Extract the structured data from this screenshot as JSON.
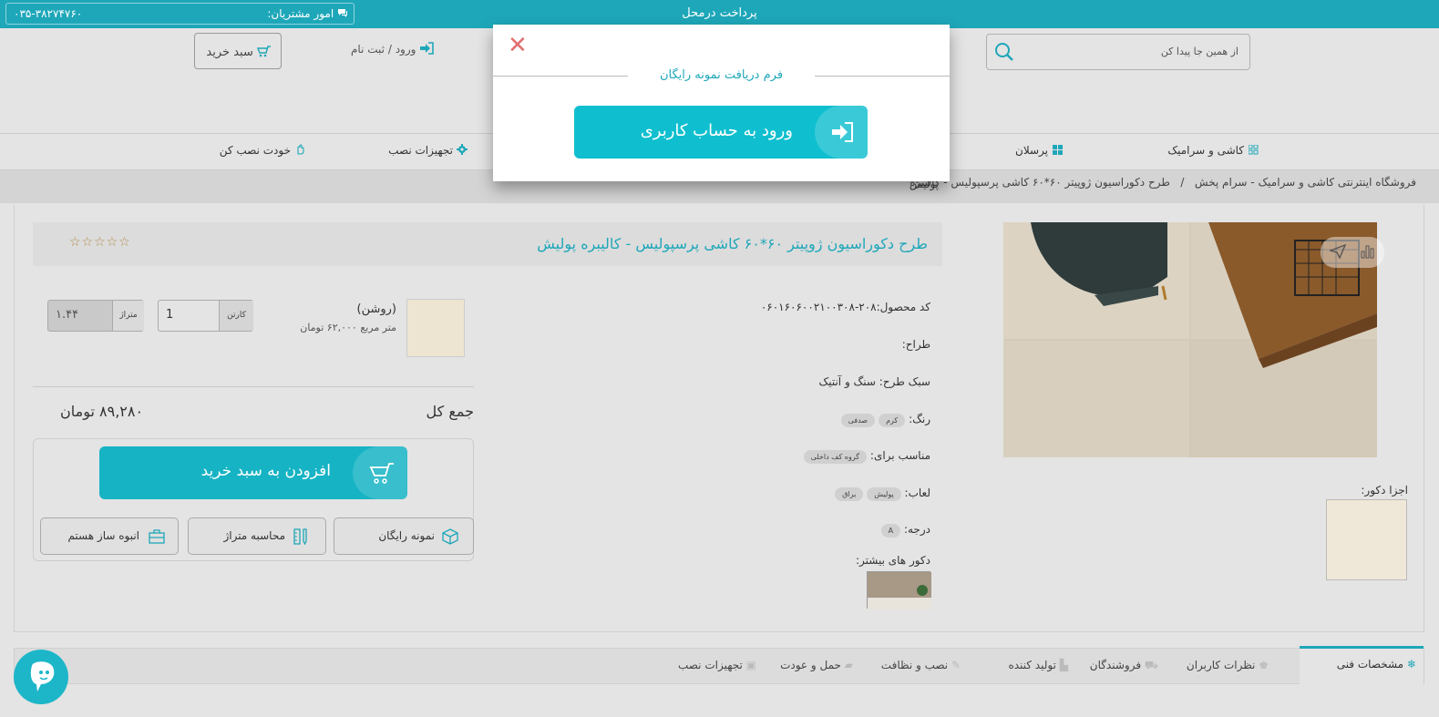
{
  "topbar": {
    "title": "پرداخت درمحل",
    "customer_service_label": "امور مشتریان:",
    "phone": "۰۳۵-۳۸۲۷۴۷۶۰"
  },
  "header": {
    "search_placeholder": "از همین جا پیدا کن",
    "login_label": "ورود",
    "register_label": "ثبت نام",
    "login_separator": "/",
    "cart_label": "سبد خرید"
  },
  "nav": {
    "items": [
      {
        "label": "کاشی و سرامیک",
        "icon": "tiles-icon"
      },
      {
        "label": "پرسلان",
        "icon": "grid-icon"
      },
      {
        "label": "تجهیزات نصب",
        "icon": "gear-icon"
      },
      {
        "label": "خودت نصب کن",
        "icon": "hand-icon"
      }
    ]
  },
  "breadcrumb": {
    "home": "فروشگاه اینترنتی کاشی و سرامیک - سرام پخش",
    "separator": "/",
    "current_line1": "طرح دکوراسیون ژوپیتر ۶۰*۶۰ کاشی پرسپولیس - کالیبره",
    "current_line2": "پولیش"
  },
  "product": {
    "title": "طرح دکوراسیون ژوپیتر ۶۰*۶۰ کاشی پرسپولیس - کالیبره پولیش",
    "stars": "☆☆☆☆☆",
    "code_label": "کد محصول:",
    "code": "۲۰۸-۰۶۰۱۶۰۶۰۰۲۱۰۰۳۰۸",
    "designer_label": "طراح:",
    "style_label": "سبک طرح:",
    "style_value": "سنگ و آنتیک",
    "color_label": "رنگ:",
    "colors": [
      "کرم",
      "صدفی"
    ],
    "suitable_label": "مناسب برای:",
    "suitable": [
      "گروه کف داخلی"
    ],
    "glaze_label": "لعاب:",
    "glazes": [
      "پولیش",
      "براق"
    ],
    "grade_label": "درجه:",
    "grade": "A",
    "more_decor_label": "دکور های بیشتر:",
    "decor_parts_label": "اجزا دکور:"
  },
  "variant": {
    "name": "(روشن)",
    "price": "متر مربع ۶۲,۰۰۰ تومان",
    "qty_unit": "کارتن",
    "qty": "1",
    "area_unit": "متراژ",
    "area": "۱.۴۴"
  },
  "totals": {
    "label": "جمع کل",
    "value": "۸۹,۲۸۰ تومان"
  },
  "actions": {
    "add_to_cart": "افزودن به سبد خرید",
    "free_sample": "نمونه رایگان",
    "calc_area": "محاسبه متراژ",
    "bulk_buyer": "انبوه ساز هستم"
  },
  "tabs": [
    {
      "label": "مشخصات فنی",
      "icon": "snowflake-icon"
    },
    {
      "label": "نظرات کاربران",
      "icon": "users-icon"
    },
    {
      "label": "فروشندگان",
      "icon": "cart-icon"
    },
    {
      "label": "تولید کننده",
      "icon": "factory-icon"
    },
    {
      "label": "نصب و نظافت",
      "icon": "wrench-icon"
    },
    {
      "label": "حمل و عودت",
      "icon": "truck-icon"
    },
    {
      "label": "تجهیزات نصب",
      "icon": "toolbox-icon"
    }
  ],
  "modal": {
    "title": "فرم دریافت نمونه رایگان",
    "button": "ورود به حساب کاربری",
    "close": "✕"
  },
  "colors": {
    "accent": "#1ea7b9",
    "button": "#16b3c4",
    "close": "#e07070"
  }
}
